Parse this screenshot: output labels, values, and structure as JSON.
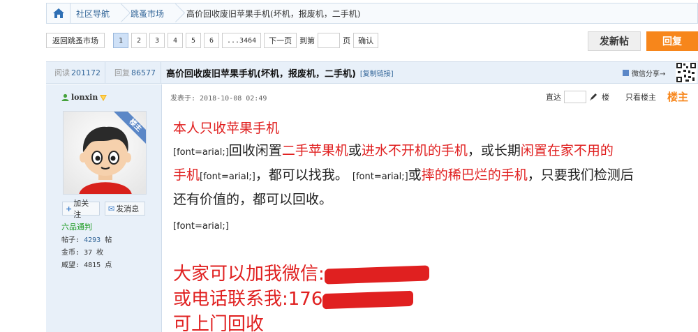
{
  "breadcrumb": {
    "home_icon": "home-icon",
    "items": [
      "社区导航",
      "跳蚤市场"
    ],
    "current": "高价回收废旧苹果手机(坏机，报废机，二手机)"
  },
  "pager": {
    "back_label": "返回跳蚤市场",
    "pages": [
      "1",
      "2",
      "3",
      "4",
      "5",
      "6",
      "...3464"
    ],
    "current_page": "1",
    "next_label": "下一页",
    "goto_prefix": "到第",
    "goto_suffix": "页",
    "confirm_label": "确认"
  },
  "actions": {
    "new_post": "发新帖",
    "reply": "回复"
  },
  "thread": {
    "views_label": "阅读",
    "views": "201172",
    "replies_label": "回复",
    "replies": "86577",
    "title": "高价回收废旧苹果手机(坏机，报废机，二手机)",
    "copy_link": "[复制链接]",
    "share_label": "微信分享→"
  },
  "author": {
    "name": "lonxin",
    "follow": "加关注",
    "message": "发消息",
    "rank": "六品通判",
    "posts_label": "帖子:",
    "posts": "4293",
    "posts_unit": "帖",
    "coins_label": "金币:",
    "coins": "37",
    "coins_unit": "枚",
    "prestige_label": "威望:",
    "prestige": "4815",
    "prestige_unit": "点",
    "badge": "楼主"
  },
  "post": {
    "posted_at": "发表于: 2018-10-08 02:49",
    "jump_label": "直达",
    "floor_label": "楼",
    "only_op": "只看楼主",
    "op_label": "楼主",
    "l1": "本人只收苹果手机",
    "l2_tag": "[font=arial;]",
    "l2_a": "回收闲置",
    "l2_b": "二手苹果机",
    "l2_c": "或",
    "l2_d": "进水不开机的手机",
    "l2_e": "，或长期",
    "l2_f": "闲置在家不用的",
    "l3_a": "手机",
    "l3_tag1": "[font=arial;]",
    "l3_b": "，都可以找我。",
    "l3_tag2": "[font=arial;]",
    "l3_c": "或",
    "l3_d": "摔的稀巴烂的手机",
    "l3_e": "，只要我们检测后",
    "l4": "还有价值的，都可以回收。",
    "l5_tag": "[font=arial;]",
    "big1": "大家可以加我微信:",
    "big2": "或电话联系我:176",
    "big3": "可上门回收"
  }
}
